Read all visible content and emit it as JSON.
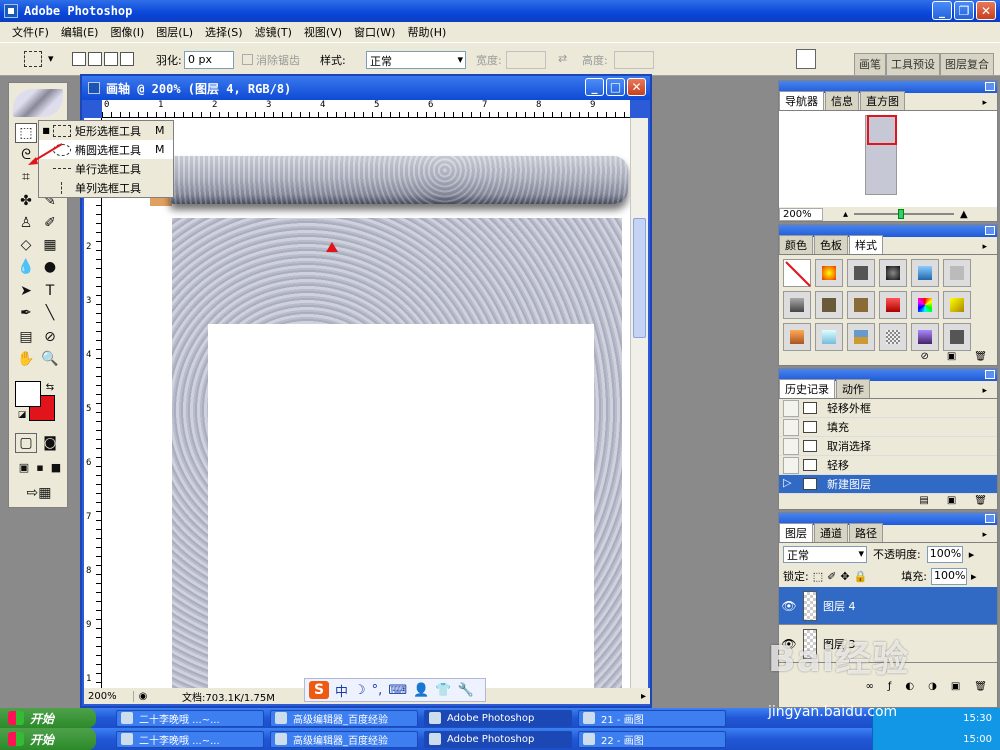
{
  "app": {
    "title": "Adobe Photoshop"
  },
  "menu": [
    "文件(F)",
    "编辑(E)",
    "图像(I)",
    "图层(L)",
    "选择(S)",
    "滤镜(T)",
    "视图(V)",
    "窗口(W)",
    "帮助(H)"
  ],
  "options": {
    "feather_label": "羽化:",
    "feather_value": "0 px",
    "antialias_label": "消除锯齿",
    "style_label": "样式:",
    "style_value": "正常",
    "width_label": "宽度:",
    "height_label": "高度:",
    "panel_tabs": [
      "画笔",
      "工具预设",
      "图层复合"
    ]
  },
  "flyout": [
    {
      "label": "矩形选框工具",
      "key": "M"
    },
    {
      "label": "椭圆选框工具",
      "key": "M"
    },
    {
      "label": "单行选框工具",
      "key": ""
    },
    {
      "label": "单列选框工具",
      "key": ""
    }
  ],
  "document": {
    "title": "画轴 @ 200% (图层 4, RGB/8)",
    "zoom": "200%",
    "doc_info": "文档:703.1K/1.75M",
    "ruler_top": [
      "0",
      "1",
      "2",
      "3",
      "4",
      "5",
      "6",
      "7",
      "8",
      "9"
    ],
    "ruler_left": [
      "1",
      "2",
      "3",
      "4",
      "5",
      "6",
      "7",
      "8",
      "9",
      "1"
    ]
  },
  "navigator": {
    "tabs": [
      "导航器",
      "信息",
      "直方图"
    ],
    "zoom": "200%"
  },
  "swatches": {
    "tabs": [
      "颜色",
      "色板",
      "样式"
    ]
  },
  "history": {
    "tabs": [
      "历史记录",
      "动作"
    ],
    "items": [
      "轻移外框",
      "填充",
      "取消选择",
      "轻移",
      "新建图层"
    ]
  },
  "layers": {
    "tabs": [
      "图层",
      "通道",
      "路径"
    ],
    "blend_mode": "正常",
    "opacity_label": "不透明度:",
    "opacity_value": "100%",
    "lock_label": "锁定:",
    "fill_label": "填充:",
    "fill_value": "100%",
    "items": [
      "图层 4",
      "图层 3"
    ]
  },
  "taskbar": {
    "start": "开始",
    "tasks": [
      "二十李晚哦 ...~...",
      "高级编辑器_百度经验",
      "Adobe Photoshop",
      "21 - 画图"
    ],
    "tasks2": [
      "二十李晚哦 ...~...",
      "高级编辑器_百度经验",
      "Adobe Photoshop",
      "22 - 画图"
    ],
    "clock": "15:30",
    "clock2": "15:00"
  },
  "watermark": {
    "text": "Bai经验",
    "url": "jingyan.baidu.com"
  }
}
